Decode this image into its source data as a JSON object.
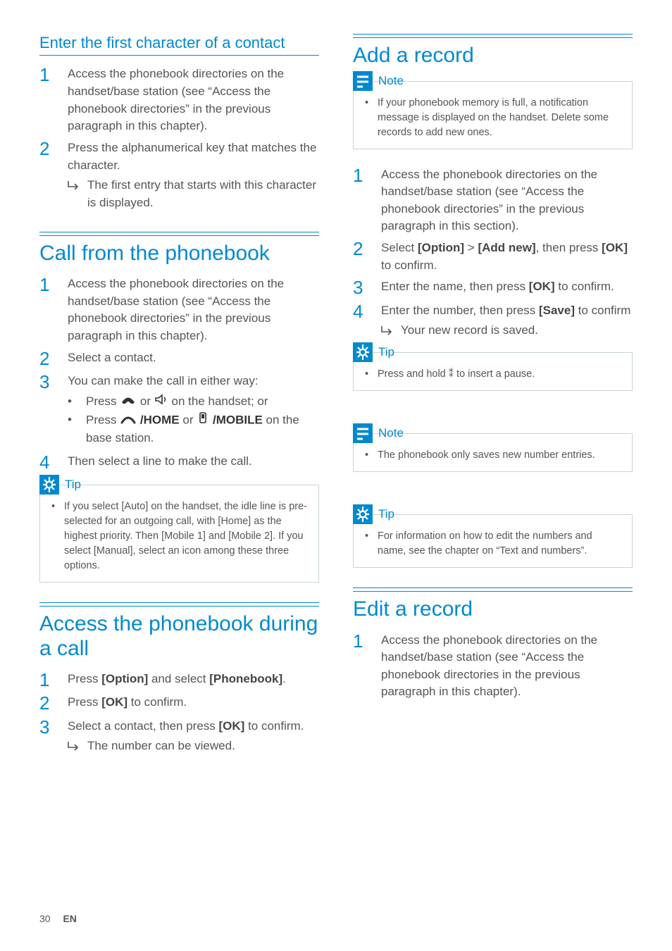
{
  "left": {
    "sec1": {
      "heading": "Enter the first character of a contact",
      "steps": [
        {
          "n": "1",
          "text": "Access the phonebook directories on the handset/base station (see “Access the phonebook directories” in the previous paragraph in this chapter)."
        },
        {
          "n": "2",
          "text": "Press the alphanumerical key that matches the character.",
          "result": "The first entry that starts with this character is displayed."
        }
      ]
    },
    "sec2": {
      "heading": "Call from the phonebook",
      "steps": [
        {
          "n": "1",
          "text": "Access the phonebook directories on the handset/base station (see “Access the phonebook directories” in the previous paragraph in this chapter)."
        },
        {
          "n": "2",
          "text": "Select a contact."
        },
        {
          "n": "3",
          "text": "You can make the call in either way:",
          "bullets": [
            {
              "pre": "Press ",
              "icons": [
                "phone",
                "speaker"
              ],
              "mid": " or ",
              "post": " on the handset; or"
            },
            {
              "pre": "Press ",
              "icons": [
                "curve"
              ],
              "label1": "/HOME",
              "mid2": " or ",
              "icons2": [
                "mobile"
              ],
              "label2": "/MOBILE",
              "post": " on the base station."
            }
          ]
        },
        {
          "n": "4",
          "text": "Then select a line to make the call."
        }
      ],
      "tip_title": "Tip",
      "tip_body": "If you select [Auto] on the handset, the idle line is pre-selected for an outgoing call, with [Home] as the highest priority. Then [Mobile 1] and [Mobile 2]. If you select [Manual], select an icon among these three options."
    },
    "sec3": {
      "heading": "Access the phonebook during a call",
      "steps": [
        {
          "n": "1",
          "pre": "Press ",
          "b1": "[Option]",
          "mid": " and select ",
          "b2": "[Phonebook]",
          "post": "."
        },
        {
          "n": "2",
          "pre": "Press ",
          "b1": "[OK]",
          "post": " to confirm."
        },
        {
          "n": "3",
          "pre": "Select a contact, then press ",
          "b1": "[OK]",
          "post": " to confirm.",
          "result": "The number can be viewed."
        }
      ]
    }
  },
  "right": {
    "sec1": {
      "heading": "Add a record",
      "note_title": "Note",
      "note_body": "If your phonebook memory is full, a notification message is displayed on the handset. Delete some records to add new ones.",
      "steps": [
        {
          "n": "1",
          "text": "Access the phonebook directories on the handset/base station (see “Access the phonebook directories” in the previous paragraph in this section)."
        },
        {
          "n": "2",
          "pre": "Select ",
          "b1": "[Option]",
          "mid": " > ",
          "b2": "[Add new]",
          "mid2": ", then press ",
          "b3": "[OK]",
          "post": " to confirm."
        },
        {
          "n": "3",
          "pre": "Enter the name, then press ",
          "b1": "[OK]",
          "post": " to confirm."
        },
        {
          "n": "4",
          "pre": "Enter the number, then press ",
          "b1": "[Save]",
          "post": " to confirm",
          "result": "Your new record is saved."
        }
      ],
      "tip1_title": "Tip",
      "tip1_body": "Press and hold ⁑ to insert a pause.",
      "note2_title": "Note",
      "note2_body": "The phonebook only saves new number entries.",
      "tip2_title": "Tip",
      "tip2_body": "For information on how to edit the numbers and name, see the chapter on “Text and numbers”."
    },
    "sec2": {
      "heading": "Edit a record",
      "steps": [
        {
          "n": "1",
          "text": "Access the phonebook directories on the handset/base station (see “Access the phonebook directories in the previous paragraph in this chapter)."
        }
      ]
    }
  },
  "footer": {
    "page": "30",
    "lang": "EN"
  }
}
